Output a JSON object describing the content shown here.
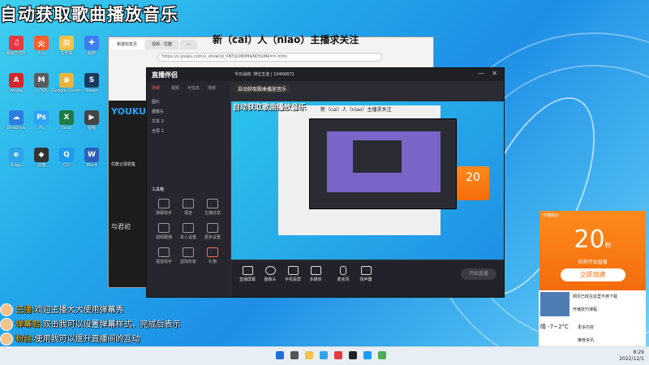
{
  "overlay_title": "自动获取歌曲播放音乐",
  "overlay_notice": "新（cai）人（niao）主播求关注",
  "desktop_icons": [
    {
      "label": "网易云音乐",
      "color": "#e8393b",
      "glyph": "♫"
    },
    {
      "label": "火山",
      "color": "#ff5e2c",
      "glyph": "火"
    },
    {
      "label": "文件夹",
      "color": "#f5c24c",
      "glyph": "▤"
    },
    {
      "label": "程序",
      "color": "#3c7df0",
      "glyph": "✚"
    },
    {
      "label": "Adobe",
      "color": "#d6262d",
      "glyph": "A"
    },
    {
      "label": "小飞机",
      "color": "#5b5b5b",
      "glyph": "M"
    },
    {
      "label": "Google Chrome",
      "color": "#eab43c",
      "glyph": "◉"
    },
    {
      "label": "Steam",
      "color": "#1a3a5d",
      "glyph": "S"
    },
    {
      "label": "OneDrive",
      "color": "#2e7de0",
      "glyph": "☁"
    },
    {
      "label": "Ps",
      "color": "#2fa3f8",
      "glyph": "Ps"
    },
    {
      "label": "Excel",
      "color": "#1f7a44",
      "glyph": "X"
    },
    {
      "label": "视频",
      "color": "#444",
      "glyph": "▶"
    },
    {
      "label": "Edge",
      "color": "#2fa4e8",
      "glyph": "e"
    },
    {
      "label": "快捷",
      "color": "#333",
      "glyph": "◆"
    },
    {
      "label": "QQ",
      "color": "#1d9bf0",
      "glyph": "Q"
    },
    {
      "label": "Word",
      "color": "#2b5fb8",
      "glyph": "W"
    }
  ],
  "browser": {
    "tabs": [
      "新建标签页",
      "视频 - 优酷",
      "—"
    ],
    "url": "https://v.youku.com/v_show/id_XNTg1MDMwNDYxMA==.html"
  },
  "youku": {
    "logo": "YOUKU",
    "line1": "优酷记录剧集",
    "line2": "与君初"
  },
  "streamer": {
    "app_name": "直播伴侣",
    "status_line": "今日战绩: 排位五连 | 10466872",
    "scene_title": "自动获取歌曲播放音乐",
    "left_tabs": [
      "场景",
      "视频",
      "可信息",
      "场景"
    ],
    "layers": [
      "图片",
      "摄像头",
      "文本 2",
      "全屏 1"
    ],
    "tools_header": "工具箱",
    "tools": [
      "弹幕助手",
      "语音",
      "主播信息",
      "视频跟播",
      "本人设置",
      "更多设置",
      "语音助手",
      "虚拟形象",
      "礼物"
    ],
    "bottom_buttons": [
      "直播屏幕",
      "摄像头",
      "手机投屏",
      "多媒体",
      "麦克风",
      "扬声器"
    ],
    "start_button": "开始直播",
    "countdown": "20"
  },
  "chat": [
    {
      "name": "主播:",
      "text": "欢迎主播大大使用弹幕秀"
    },
    {
      "name": "弹幕君:",
      "text": "双击我可以设置弹幕样式，完成后表示"
    },
    {
      "name": "粉丝:",
      "text": "使用我可以提升直播间的互动"
    }
  ],
  "countdown_popup": {
    "header": "开播提示",
    "number": "20",
    "unit": "秒",
    "sub": "后将开始直播",
    "button": "立即加速"
  },
  "news_items": [
    "网页已经在这里不用下载",
    "开播技巧课程",
    "更多内容",
    "推荐资讯"
  ],
  "weather": {
    "temp": "-7~2°C",
    "city": "晴"
  },
  "clock": {
    "time": "8:29",
    "date": "2022/12/1"
  }
}
